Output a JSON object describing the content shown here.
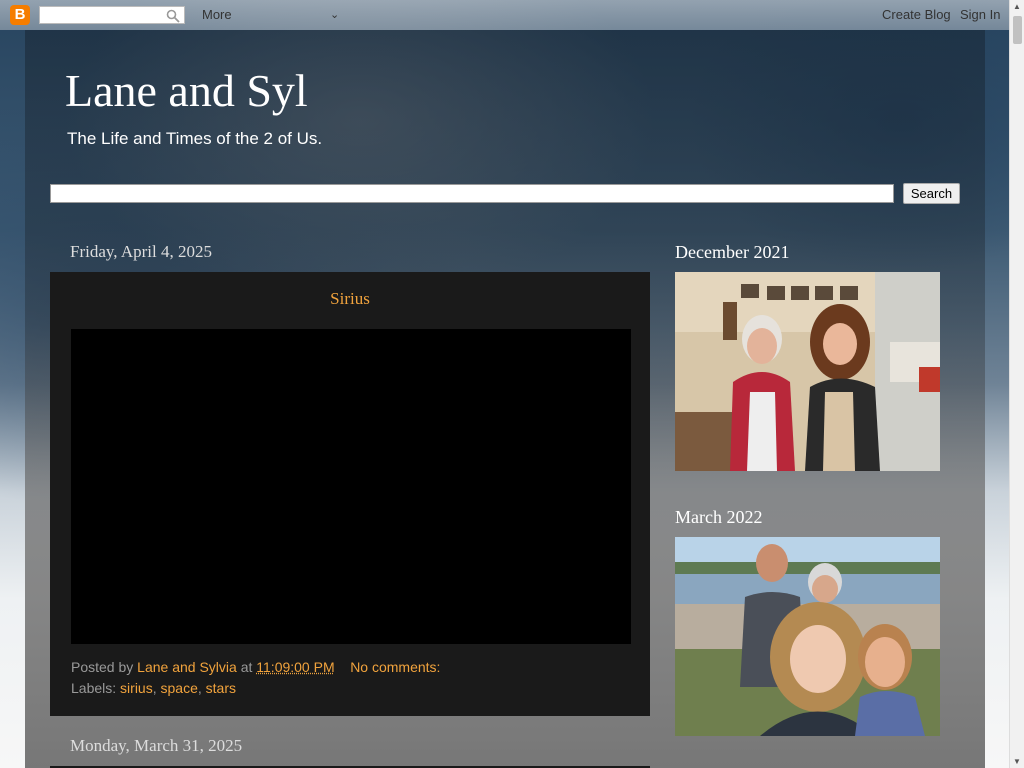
{
  "navbar": {
    "more_label": "More",
    "create_blog_label": "Create Blog",
    "sign_in_label": "Sign In"
  },
  "header": {
    "title": "Lane and Syl",
    "description": "The Life and Times of the 2 of Us."
  },
  "search": {
    "button_label": "Search"
  },
  "posts": [
    {
      "date": "Friday, April 4, 2025",
      "title": "Sirius",
      "posted_by_prefix": "Posted by",
      "author": "Lane and Sylvia",
      "at": "at",
      "time": "11:09:00 PM",
      "comments": "No comments:",
      "labels_prefix": "Labels:",
      "labels": [
        "sirius",
        "space",
        "stars"
      ]
    },
    {
      "date": "Monday, March 31, 2025"
    }
  ],
  "sidebar": [
    {
      "title": "December 2021"
    },
    {
      "title": "March 2022"
    }
  ],
  "colors": {
    "link": "#f1a33d",
    "post_bg": "#1a1a1a"
  }
}
